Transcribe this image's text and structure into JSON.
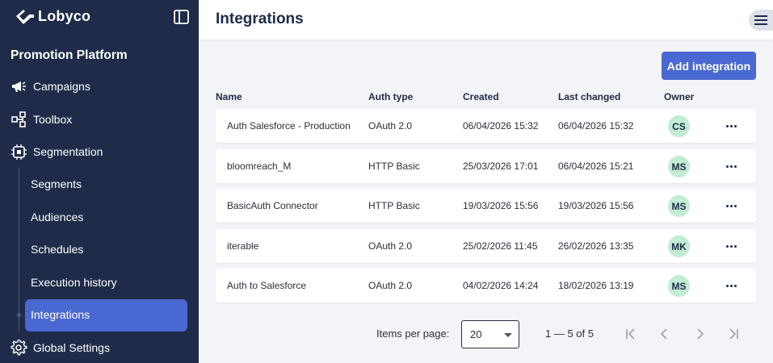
{
  "brand": {
    "name": "Lobyco"
  },
  "sidebar": {
    "section_title": "Promotion Platform",
    "items": [
      {
        "label": "Campaigns",
        "icon": "megaphone-icon"
      },
      {
        "label": "Toolbox",
        "icon": "tool-icon"
      },
      {
        "label": "Segmentation",
        "icon": "chip-icon"
      }
    ],
    "sub_items": [
      {
        "label": "Segments"
      },
      {
        "label": "Audiences"
      },
      {
        "label": "Schedules"
      },
      {
        "label": "Execution history"
      },
      {
        "label": "Integrations",
        "active": true
      }
    ],
    "bottom_item": {
      "label": "Global Settings",
      "icon": "gear-icon"
    }
  },
  "header": {
    "title": "Integrations"
  },
  "main": {
    "add_button": "Add integration",
    "columns": [
      "Name",
      "Auth type",
      "Created",
      "Last changed",
      "Owner"
    ],
    "rows": [
      {
        "name": "Auth Salesforce - Production",
        "auth": "OAuth 2.0",
        "created": "06/04/2026 15:32",
        "changed": "06/04/2026 15:32",
        "owner": "CS"
      },
      {
        "name": "bloomreach_M",
        "auth": "HTTP Basic",
        "created": "25/03/2026 17:01",
        "changed": "06/04/2026 15:21",
        "owner": "MS"
      },
      {
        "name": "BasicAuth Connector",
        "auth": "HTTP Basic",
        "created": "19/03/2026 15:56",
        "changed": "19/03/2026 15:56",
        "owner": "MS"
      },
      {
        "name": "iterable",
        "auth": "OAuth 2.0",
        "created": "25/02/2026 11:45",
        "changed": "26/02/2026 13:35",
        "owner": "MK"
      },
      {
        "name": "Auth to Salesforce",
        "auth": "OAuth 2.0",
        "created": "04/02/2026 14:24",
        "changed": "18/02/2026 13:19",
        "owner": "MS"
      }
    ]
  },
  "pagination": {
    "items_per_page_label": "Items per page:",
    "items_per_page_value": "20",
    "range": "1 — 5 of 5"
  },
  "colors": {
    "sidebar_bg": "#1f2b48",
    "accent": "#4a68d1",
    "avatar_bg": "#c3ecd4"
  }
}
